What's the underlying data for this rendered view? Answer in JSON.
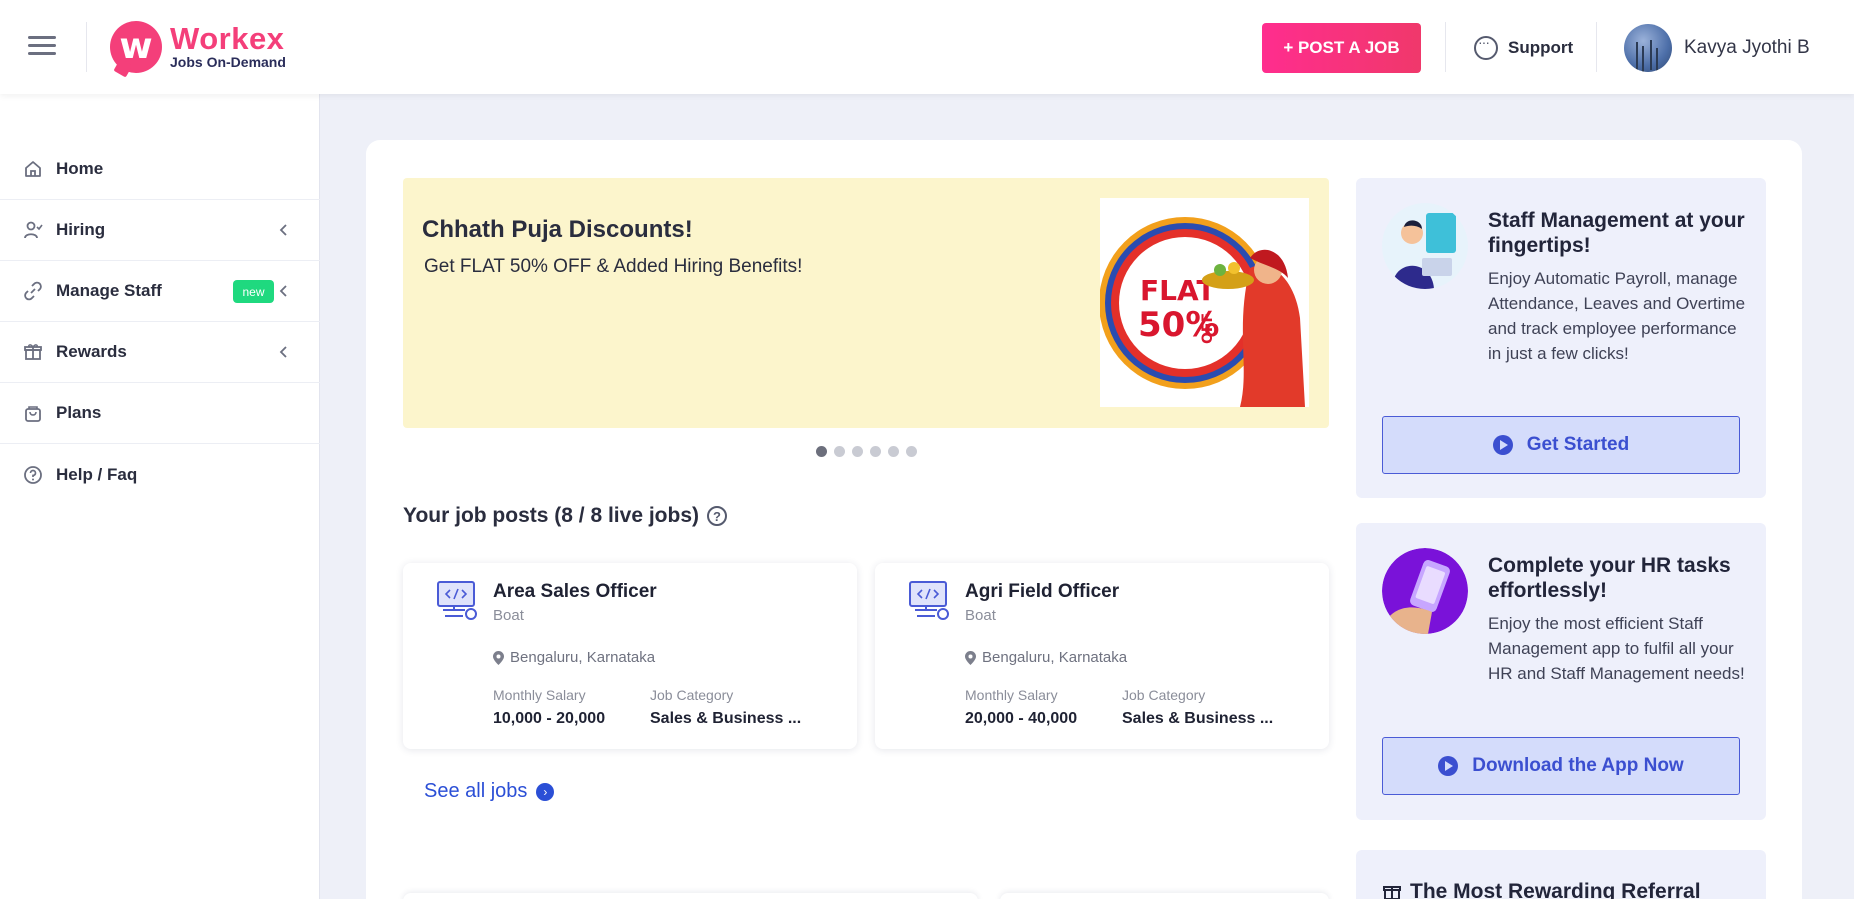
{
  "header": {
    "logo_name": "Workex",
    "logo_tagline": "Jobs On-Demand",
    "post_job_label": "+ POST A JOB",
    "support_label": "Support",
    "user_name": "Kavya Jyothi B"
  },
  "sidebar": {
    "items": [
      {
        "label": "Home",
        "icon": "home-icon"
      },
      {
        "label": "Hiring",
        "icon": "hiring-icon"
      },
      {
        "label": "Manage Staff",
        "icon": "link-icon",
        "badge": "new"
      },
      {
        "label": "Rewards",
        "icon": "gift-icon"
      },
      {
        "label": "Plans",
        "icon": "bag-icon"
      },
      {
        "label": "Help / Faq",
        "icon": "help-icon"
      }
    ]
  },
  "banner": {
    "title": "Chhath Puja Discounts!",
    "subtitle": "Get FLAT 50% OFF & Added Hiring Benefits!",
    "image_text_flat": "FLAT",
    "image_text_pct": "50%",
    "image_text_off": "OFF",
    "slide_count": 6,
    "active_slide": 1
  },
  "jobs": {
    "title": "Your job posts (8 / 8 live jobs)",
    "see_all_label": "See all jobs",
    "salary_label": "Monthly Salary",
    "category_label": "Job Category",
    "items": [
      {
        "title": "Area Sales Officer",
        "company": "Boat",
        "location": "Bengaluru, Karnataka",
        "salary": "10,000 - 20,000",
        "category": "Sales & Business ..."
      },
      {
        "title": "Agri Field Officer",
        "company": "Boat",
        "location": "Bengaluru, Karnataka",
        "salary": "20,000 - 40,000",
        "category": "Sales & Business ..."
      }
    ]
  },
  "promos": [
    {
      "title": "Staff Management at your fingertips!",
      "text": "Enjoy Automatic Payroll, manage Attendance, Leaves and Overtime and track employee performance in just a few clicks!",
      "button": "Get Started"
    },
    {
      "title": "Complete your HR tasks effortlessly!",
      "text": "Enjoy the most efficient Staff Management app to fulfil all your HR and Staff Management needs!",
      "button": "Download the App Now"
    },
    {
      "title": "The Most Rewarding Referral"
    }
  ],
  "colors": {
    "brand_pink": "#f43f7a",
    "accent_blue": "#2b4fd6",
    "new_badge": "#1fd97f",
    "banner_bg": "#fcf5cc"
  }
}
